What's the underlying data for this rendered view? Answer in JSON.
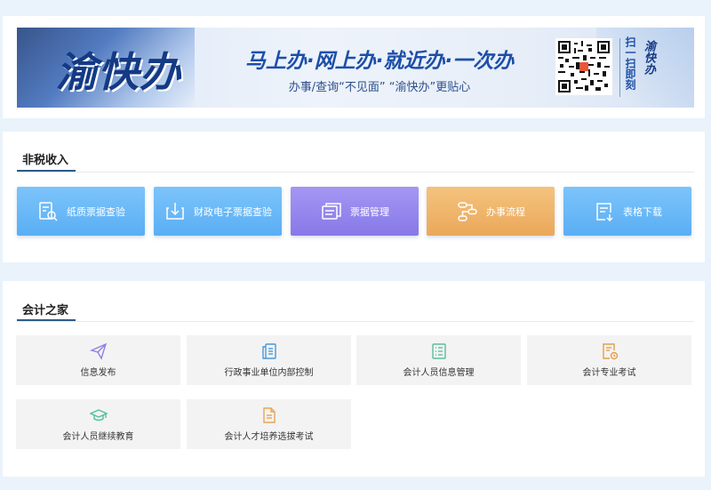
{
  "banner": {
    "logo_text": "渝快办",
    "slogan": "马上办·网上办·就近办·一次办",
    "subtitle": "办事/查询“不见面” “渝快办”更贴心",
    "scan_text": "扫一扫即刻",
    "scan_brand": "渝快办",
    "colors": {
      "primary": "#1d4fa8",
      "dark": "#143a84"
    }
  },
  "nontax": {
    "title": "非税收入",
    "buttons": [
      {
        "label": "纸质票据查验",
        "icon": "document-search-icon",
        "color": "blue"
      },
      {
        "label": "财政电子票据查验",
        "icon": "download-tray-icon",
        "color": "blue"
      },
      {
        "label": "票据管理",
        "icon": "stacked-documents-icon",
        "color": "purple"
      },
      {
        "label": "办事流程",
        "icon": "workflow-icon",
        "color": "orange"
      },
      {
        "label": "表格下载",
        "icon": "form-download-icon",
        "color": "blue"
      }
    ]
  },
  "accounting": {
    "title": "会计之家",
    "tiles": [
      {
        "label": "信息发布",
        "icon": "paper-plane-icon",
        "color": "#8f7fe6"
      },
      {
        "label": "行政事业单位内部控制",
        "icon": "document-list-icon",
        "color": "#4a98d8"
      },
      {
        "label": "会计人员信息管理",
        "icon": "list-icon",
        "color": "#5bbf9a"
      },
      {
        "label": "会计专业考试",
        "icon": "exam-clock-icon",
        "color": "#e3a04a"
      },
      {
        "label": "会计人员继续教育",
        "icon": "graduation-cap-icon",
        "color": "#4fc0a0"
      },
      {
        "label": "会计人才培养选拔考试",
        "icon": "document-text-icon",
        "color": "#e8a552"
      }
    ]
  }
}
